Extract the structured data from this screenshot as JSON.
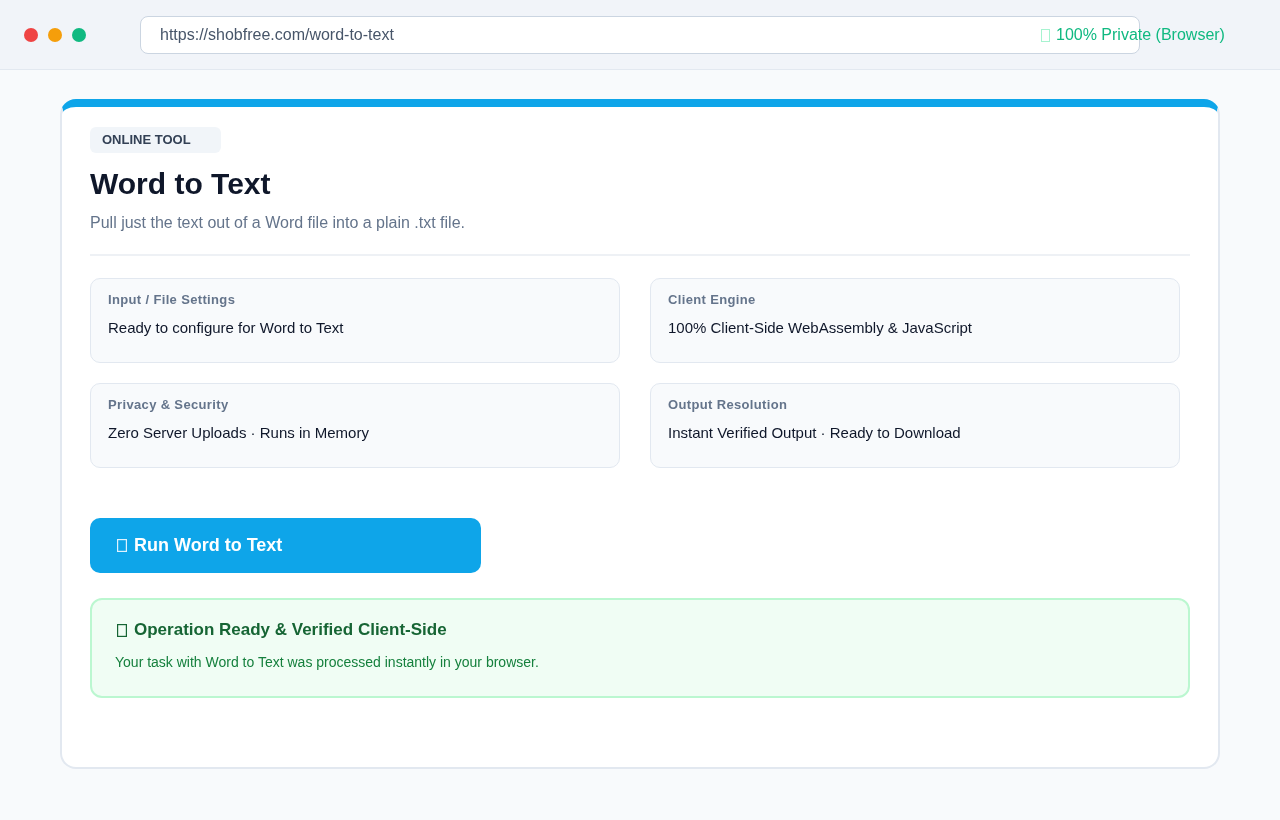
{
  "window": {
    "controls": [
      {
        "color": "#ef4444"
      },
      {
        "color": "#f59e0b"
      },
      {
        "color": "#10b981"
      }
    ]
  },
  "address_bar": {
    "url": "https://shobfree.com/word-to-text",
    "privacy_label": "100% Private (Browser)"
  },
  "tool": {
    "badge": "ONLINE TOOL",
    "title": "Word to Text",
    "subtitle": "Pull just the text out of a Word file into a plain .txt file.",
    "info_cards": [
      {
        "label": "Input / File Settings",
        "value": "Ready to configure for Word to Text"
      },
      {
        "label": "Client Engine",
        "value": "100% Client-Side WebAssembly & JavaScript"
      },
      {
        "label": "Privacy & Security",
        "value": "Zero Server Uploads · Runs in Memory"
      },
      {
        "label": "Output Resolution",
        "value": "Instant Verified Output · Ready to Download"
      }
    ],
    "run_button": {
      "label": "Run Word to Text"
    },
    "status": {
      "title": "Operation Ready & Verified Client-Side",
      "message": "Your task with Word to Text was processed instantly in your browser."
    }
  }
}
